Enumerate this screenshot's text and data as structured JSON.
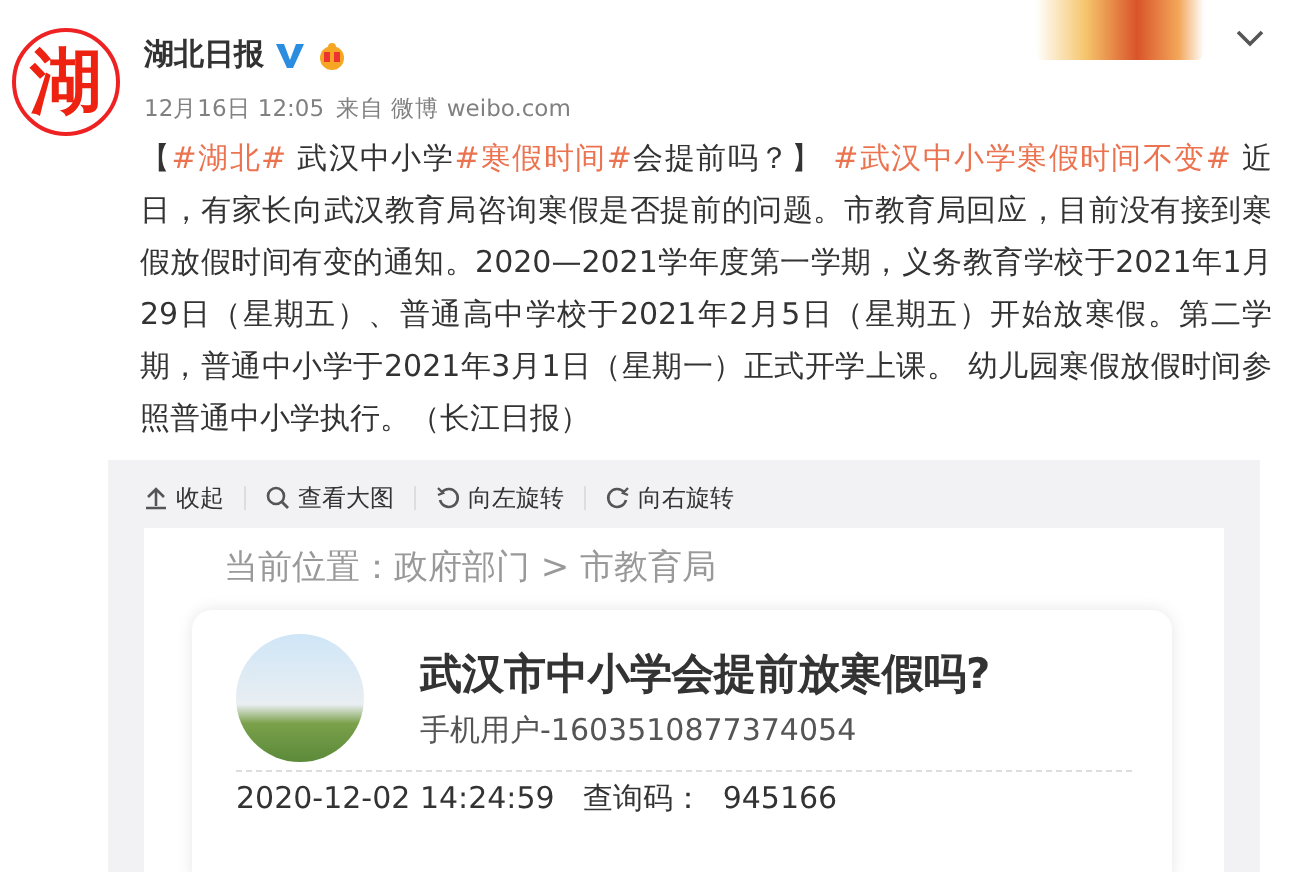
{
  "author": {
    "avatar_text": "湖",
    "name": "湖北日报",
    "verified": true,
    "time": "12月16日 12:05",
    "source": "来自 微博 weibo.com"
  },
  "post": [
    {
      "kind": "text",
      "text": "【"
    },
    {
      "kind": "hashtag",
      "text": "#湖北#"
    },
    {
      "kind": "text",
      "text": " 武汉中小学"
    },
    {
      "kind": "hashtag",
      "text": "#寒假时间#"
    },
    {
      "kind": "text",
      "text": "会提前吗？】 "
    },
    {
      "kind": "hashtag",
      "text": "#武汉中小学寒假时间不变#"
    },
    {
      "kind": "text",
      "text": " 近日，有家长向武汉教育局咨询寒假是否提前的问题。市教育局回应，目前没有接到寒假放假时间有变的通知。2020—2021学年度第一学期，义务教育学校于2021年1月29日（星期五）、普通高中学校于2021年2月5日（星期五）开始放寒假。第二学期，普通中小学于2021年3月1日（星期一）正式开学上课。 幼儿园寒假放假时间参照普通中小学执行。（长江日报）"
    }
  ],
  "toolbar": [
    {
      "kind": "collapse",
      "label": "收起"
    },
    {
      "kind": "zoom",
      "label": "查看大图"
    },
    {
      "kind": "rotate_left",
      "label": "向左旋转"
    },
    {
      "kind": "rotate_right",
      "label": "向右旋转"
    }
  ],
  "image": {
    "breadcrumb": "当前位置：政府部门 > 市教育局",
    "title": "武汉市中小学会提前放寒假吗?",
    "user": "手机用户-1603510877374054",
    "date": "2020-12-02 14:24:59",
    "code_label": "查询码：",
    "code": "945166"
  }
}
